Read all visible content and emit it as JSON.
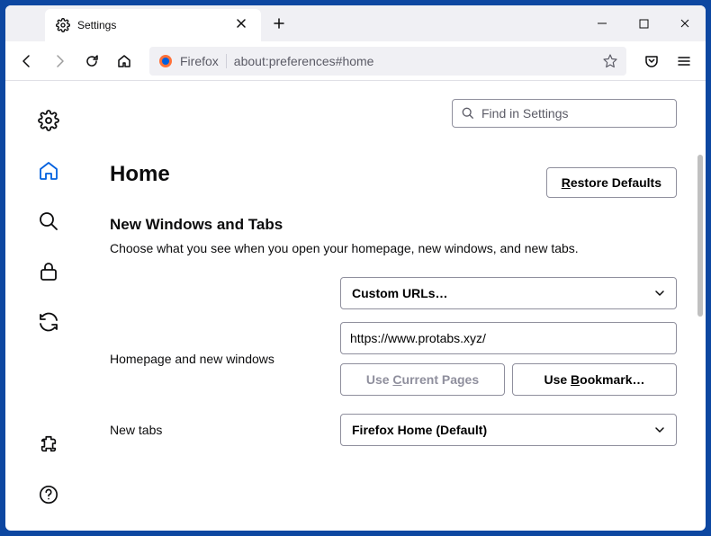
{
  "tab": {
    "title": "Settings"
  },
  "urlbar": {
    "brand": "Firefox",
    "url": "about:preferences#home"
  },
  "search": {
    "placeholder": "Find in Settings"
  },
  "page": {
    "title": "Home"
  },
  "buttons": {
    "restore_defaults": "Restore Defaults",
    "use_current": "Use Current Pages",
    "use_bookmark": "Use Bookmark…"
  },
  "section": {
    "title": "New Windows and Tabs",
    "description": "Choose what you see when you open your homepage, new windows, and new tabs."
  },
  "fields": {
    "homepage_label": "Homepage and new windows",
    "homepage_select": "Custom URLs…",
    "homepage_url": "https://www.protabs.xyz/",
    "newtabs_label": "New tabs",
    "newtabs_select": "Firefox Home (Default)"
  }
}
